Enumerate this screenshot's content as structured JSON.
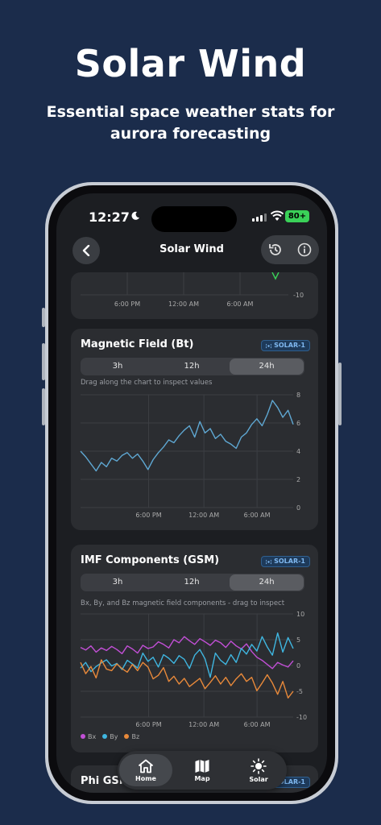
{
  "promo": {
    "title": "Solar Wind",
    "subtitle": "Essential  space weather stats for aurora forecasting"
  },
  "status_bar": {
    "time": "12:27",
    "battery": "80+"
  },
  "nav": {
    "title": "Solar Wind"
  },
  "top_card": {
    "x_ticks": [
      "6:00 PM",
      "12:00 AM",
      "6:00 AM"
    ],
    "y_tick": "-10"
  },
  "magnetic_field": {
    "title": "Magnetic Field (Bt)",
    "badge": "SOLAR-1",
    "ranges": [
      "3h",
      "12h",
      "24h"
    ],
    "selected_range": "24h",
    "hint": "Drag along the chart to inspect values"
  },
  "imf": {
    "title": "IMF Components (GSM)",
    "badge": "SOLAR-1",
    "ranges": [
      "3h",
      "12h",
      "24h"
    ],
    "selected_range": "24h",
    "hint": "Bx, By, and Bz magnetic field components - drag to inspect",
    "legend": [
      "Bx",
      "By",
      "Bz"
    ]
  },
  "phi": {
    "title": "Phi GSM",
    "badge": "SOLAR-1"
  },
  "tabs": [
    {
      "label": "Home",
      "icon": "home-icon",
      "active": true
    },
    {
      "label": "Map",
      "icon": "map-icon",
      "active": false
    },
    {
      "label": "Solar",
      "icon": "sun-icon",
      "active": false
    }
  ],
  "colors": {
    "background": "#1b2c4b",
    "bt_line": "#5fa8d3",
    "bx": "#c24fd6",
    "by": "#3fb6e0",
    "bz": "#e8893a",
    "badge_text": "#7fb8f0"
  },
  "chart_data": [
    {
      "type": "line",
      "title": "Magnetic Field (Bt)",
      "x": [
        "6:00 PM",
        "12:00 AM",
        "6:00 AM"
      ],
      "ylim": [
        0,
        8
      ],
      "yticks": [
        0,
        2,
        4,
        6,
        8
      ],
      "series": [
        {
          "values": [
            4.0,
            3.6,
            3.1,
            2.6,
            3.2,
            2.9,
            3.5,
            3.3,
            3.7,
            3.9,
            3.5,
            3.8,
            3.3,
            2.7,
            3.4,
            3.9,
            4.3,
            4.8,
            4.6,
            5.1,
            5.5,
            5.8,
            5.0,
            6.1,
            5.3,
            5.6,
            4.9,
            5.2,
            4.7,
            4.5,
            4.2,
            5.0,
            5.3,
            5.9,
            6.3,
            5.8,
            6.6,
            7.6,
            7.1,
            6.4,
            6.9,
            5.9
          ]
        }
      ]
    },
    {
      "type": "line",
      "title": "IMF Components (GSM)",
      "x": [
        "6:00 PM",
        "12:00 AM",
        "6:00 AM"
      ],
      "ylim": [
        -10,
        10
      ],
      "yticks": [
        -10,
        -5,
        0,
        5,
        10
      ],
      "series": [
        {
          "name": "Bx",
          "values": [
            3.5,
            3.0,
            3.8,
            2.6,
            3.4,
            2.9,
            3.7,
            3.1,
            2.3,
            3.8,
            3.2,
            2.4,
            3.9,
            3.3,
            3.6,
            4.6,
            4.1,
            3.4,
            5.0,
            4.4,
            5.6,
            4.8,
            4.1,
            5.2,
            4.6,
            3.9,
            4.9,
            4.4,
            3.5,
            4.7,
            3.8,
            3.2,
            4.2,
            2.7,
            1.6,
            1.0,
            0.2,
            -0.6,
            0.6,
            0.1,
            -0.3,
            0.9
          ]
        },
        {
          "name": "By",
          "values": [
            -0.5,
            0.6,
            -1.2,
            -0.2,
            0.5,
            1.1,
            -0.1,
            0.4,
            -0.8,
            1.0,
            0.3,
            -0.5,
            2.4,
            0.8,
            1.6,
            -0.3,
            2.1,
            1.4,
            0.4,
            1.9,
            1.2,
            -0.6,
            2.0,
            3.1,
            1.3,
            -2.3,
            2.4,
            1.0,
            0.2,
            2.1,
            0.6,
            3.3,
            2.2,
            4.1,
            2.8,
            5.6,
            3.6,
            2.0,
            6.3,
            2.6,
            5.4,
            3.3
          ]
        },
        {
          "name": "Bz",
          "values": [
            0.6,
            -1.6,
            -0.2,
            -2.4,
            1.1,
            -0.7,
            -1.0,
            0.3,
            -0.6,
            -1.3,
            0.2,
            -1.0,
            0.6,
            -0.3,
            -2.6,
            -1.9,
            -0.4,
            -3.1,
            -2.1,
            -3.6,
            -2.5,
            -4.1,
            -3.3,
            -2.5,
            -4.5,
            -3.3,
            -2.0,
            -3.6,
            -2.3,
            -3.9,
            -2.6,
            -1.6,
            -3.1,
            -2.3,
            -4.9,
            -3.4,
            -1.8,
            -3.4,
            -5.6,
            -3.1,
            -6.3,
            -5.0
          ]
        }
      ]
    }
  ]
}
